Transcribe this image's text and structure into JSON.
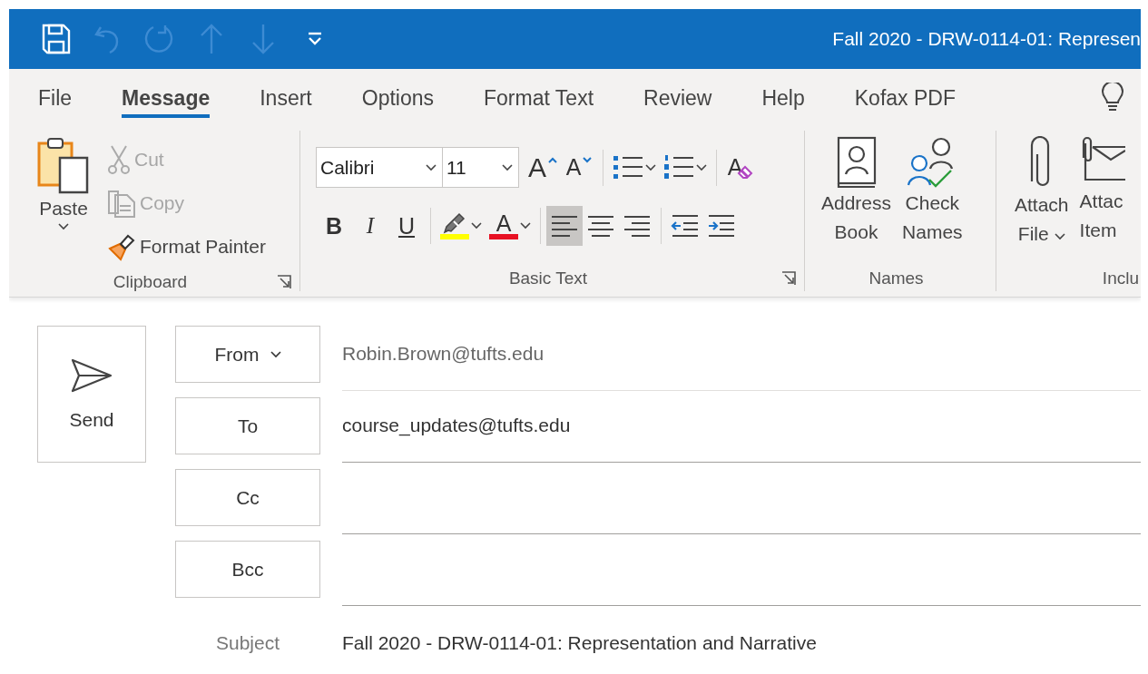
{
  "quick_access": [
    {
      "kind": "save",
      "disabled": false
    },
    {
      "kind": "undo",
      "disabled": true
    },
    {
      "kind": "redo",
      "disabled": true
    },
    {
      "kind": "up",
      "disabled": true
    },
    {
      "kind": "down",
      "disabled": true
    },
    {
      "kind": "customize",
      "disabled": false
    }
  ],
  "window": {
    "title": "Fall 2020 - DRW-0114-01: Represen"
  },
  "tabs": [
    {
      "label": "File",
      "selected": false
    },
    {
      "label": "Message",
      "selected": true
    },
    {
      "label": "Insert",
      "selected": false
    },
    {
      "label": "Options",
      "selected": false
    },
    {
      "label": "Format Text",
      "selected": false
    },
    {
      "label": "Review",
      "selected": false
    },
    {
      "label": "Help",
      "selected": false
    },
    {
      "label": "Kofax PDF",
      "selected": false
    }
  ],
  "clipboard": {
    "label": "Clipboard",
    "paste": "Paste",
    "items": [
      {
        "kind": "cut",
        "label": "Cut",
        "disabled": true
      },
      {
        "kind": "copy",
        "label": "Copy",
        "disabled": true
      },
      {
        "kind": "painter",
        "label": "Format Painter",
        "disabled": false
      }
    ]
  },
  "basic_text": {
    "label": "Basic Text",
    "font": "Calibri",
    "size": "11",
    "row1": [
      [
        {
          "kind": "grow",
          "glyph": "A",
          "has_menu": false,
          "selected": false
        },
        {
          "kind": "shrink",
          "glyph": "A",
          "has_menu": false,
          "selected": false
        }
      ],
      [
        {
          "kind": "bullets",
          "has_menu": true,
          "selected": false
        },
        {
          "kind": "numbering",
          "has_menu": true,
          "selected": false
        }
      ],
      [
        {
          "kind": "clear",
          "glyph": "A",
          "has_menu": false,
          "selected": false
        }
      ]
    ],
    "row2": [
      [
        {
          "kind": "bold",
          "glyph": "B",
          "has_menu": false,
          "selected": false
        },
        {
          "kind": "italic",
          "glyph": "I",
          "has_menu": false,
          "selected": false
        },
        {
          "kind": "underline",
          "glyph": "U",
          "has_menu": false,
          "selected": false
        }
      ],
      [
        {
          "kind": "highlight",
          "has_menu": true,
          "selected": false,
          "color": "#ffff00"
        },
        {
          "kind": "font_color",
          "glyph": "A",
          "has_menu": true,
          "selected": false,
          "color": "#e81123"
        }
      ],
      [
        {
          "kind": "align_left",
          "has_menu": false,
          "selected": true
        },
        {
          "kind": "align_center",
          "has_menu": false,
          "selected": false
        },
        {
          "kind": "align_right",
          "has_menu": false,
          "selected": false
        }
      ],
      [
        {
          "kind": "outdent",
          "has_menu": false,
          "selected": false
        },
        {
          "kind": "indent",
          "has_menu": false,
          "selected": false
        }
      ]
    ]
  },
  "names": {
    "label": "Names",
    "buttons": [
      {
        "kind": "address_book",
        "lines": [
          "Address",
          "Book"
        ],
        "has_menu": false
      },
      {
        "kind": "check_names",
        "lines": [
          "Check",
          "Names"
        ],
        "has_menu": false
      }
    ]
  },
  "include": {
    "label": "Inclu",
    "buttons": [
      {
        "kind": "attach_file",
        "lines": [
          "Attach",
          "File"
        ],
        "has_menu": true
      },
      {
        "kind": "attach_item",
        "lines": [
          "Attac",
          "Item"
        ],
        "has_menu": false
      }
    ]
  },
  "compose": {
    "send": "Send",
    "fields": [
      {
        "label": "From",
        "has_menu": true,
        "value": "Robin.Brown@tufts.edu",
        "editable": false
      },
      {
        "label": "To",
        "has_menu": false,
        "value": "course_updates@tufts.edu",
        "editable": true
      },
      {
        "label": "Cc",
        "has_menu": false,
        "editable": true
      },
      {
        "label": "Bcc",
        "has_menu": false,
        "editable": true
      }
    ],
    "subject": {
      "label": "Subject",
      "value": "Fall 2020 - DRW-0114-01: Representation and Narrative"
    }
  }
}
